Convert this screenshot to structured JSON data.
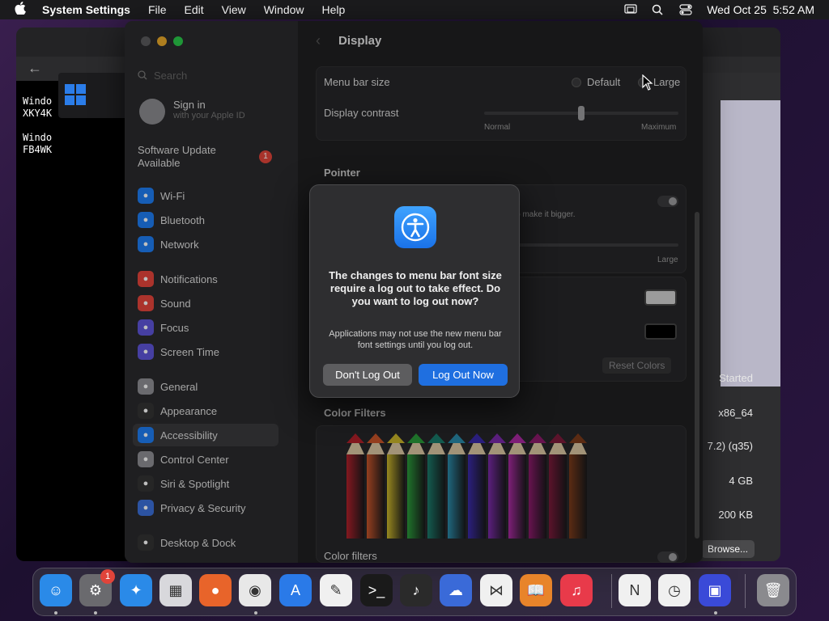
{
  "menubar": {
    "app_name": "System Settings",
    "items": [
      "File",
      "Edit",
      "View",
      "Window",
      "Help"
    ],
    "datetime": "Wed Oct 25  5:52 AM"
  },
  "background_window": {
    "left_text": "Windo\nXKY4K\n\nWindo\nFB4WK",
    "values": [
      "Started",
      "x86_64",
      "7.2) (q35)",
      "4 GB",
      "200 KB"
    ],
    "browse_label": "Browse..."
  },
  "sidebar": {
    "search_placeholder": "Search",
    "signin_title": "Sign in",
    "signin_subtitle": "with your Apple ID",
    "software_update": "Software Update Available",
    "software_update_badge": "1",
    "items": [
      {
        "label": "Wi-Fi",
        "icon": "wifi-icon",
        "color": "#1e7cf2"
      },
      {
        "label": "Bluetooth",
        "icon": "bluetooth-icon",
        "color": "#1e7cf2"
      },
      {
        "label": "Network",
        "icon": "network-icon",
        "color": "#1e7cf2"
      },
      {
        "label": "Notifications",
        "icon": "bell-icon",
        "color": "#e5453b"
      },
      {
        "label": "Sound",
        "icon": "speaker-icon",
        "color": "#e5453b"
      },
      {
        "label": "Focus",
        "icon": "moon-icon",
        "color": "#5e55d8"
      },
      {
        "label": "Screen Time",
        "icon": "hourglass-icon",
        "color": "#5e55d8"
      },
      {
        "label": "General",
        "icon": "gear-icon",
        "color": "#8e8e93"
      },
      {
        "label": "Appearance",
        "icon": "appearance-icon",
        "color": "#333"
      },
      {
        "label": "Accessibility",
        "icon": "accessibility-icon",
        "color": "#1e7cf2"
      },
      {
        "label": "Control Center",
        "icon": "control-center-icon",
        "color": "#8e8e93"
      },
      {
        "label": "Siri & Spotlight",
        "icon": "siri-icon",
        "color": "#333"
      },
      {
        "label": "Privacy & Security",
        "icon": "hand-icon",
        "color": "#3b6fd8"
      },
      {
        "label": "Desktop & Dock",
        "icon": "dock-icon",
        "color": "#333"
      }
    ]
  },
  "content": {
    "title": "Display",
    "menu_bar_size_label": "Menu bar size",
    "menu_bar_size_options": [
      "Default",
      "Large"
    ],
    "display_contrast_label": "Display contrast",
    "contrast_min": "Normal",
    "contrast_max": "Maximum",
    "contrast_level": 0.5,
    "pointer_title": "Pointer",
    "pointer_hint": "n to make it bigger.",
    "pointer_size_max": "Large",
    "reset_colors": "Reset Colors",
    "color_filters_title": "Color Filters",
    "color_filters_label": "Color filters",
    "pencil_colors": [
      "#b0202a",
      "#c8542a",
      "#c9b52a",
      "#2a9a3a",
      "#1a7a6a",
      "#2a8aa8",
      "#3a2aa8",
      "#7a2aa8",
      "#a82aa0",
      "#8a1a6a",
      "#7a1a3a",
      "#7a3a1a"
    ]
  },
  "dialog": {
    "title": "The changes to menu bar font size require a log out to take effect. Do you want to log out now?",
    "body": "Applications may not use the new menu bar font settings until you log out.",
    "secondary_button": "Don't Log Out",
    "primary_button": "Log Out Now"
  },
  "dock": {
    "settings_badge": "1",
    "apps": [
      {
        "name": "finder-icon",
        "color": "#2a8ae8",
        "glyph": "☺"
      },
      {
        "name": "system-settings-icon",
        "color": "#6a6a6e",
        "glyph": "⚙"
      },
      {
        "name": "safari-icon",
        "color": "#2a8ae8",
        "glyph": "✦"
      },
      {
        "name": "launchpad-icon",
        "color": "#d8d8dc",
        "glyph": "▦"
      },
      {
        "name": "firefox-icon",
        "color": "#e8642a",
        "glyph": "●"
      },
      {
        "name": "chrome-icon",
        "color": "#e8e8e8",
        "glyph": "◉"
      },
      {
        "name": "app-store-icon",
        "color": "#2a7ae8",
        "glyph": "A"
      },
      {
        "name": "textedit-icon",
        "color": "#f0f0f0",
        "glyph": "✎"
      },
      {
        "name": "terminal-icon",
        "color": "#1a1a1a",
        "glyph": ">_"
      },
      {
        "name": "garageband-icon",
        "color": "#2a2a2a",
        "glyph": "♪"
      },
      {
        "name": "weather-icon",
        "color": "#3a6ad8",
        "glyph": "☁"
      },
      {
        "name": "vscode-icon",
        "color": "#f0f0f0",
        "glyph": "⋈"
      },
      {
        "name": "books-icon",
        "color": "#e8842a",
        "glyph": "📖"
      },
      {
        "name": "music-icon",
        "color": "#e83a4a",
        "glyph": "♫"
      },
      {
        "name": "news-icon",
        "color": "#f0f0f0",
        "glyph": "N"
      },
      {
        "name": "clock-icon",
        "color": "#f0f0f0",
        "glyph": "◷"
      },
      {
        "name": "screen-sharing-icon",
        "color": "#3a4ad8",
        "glyph": "▣"
      },
      {
        "name": "trash-icon",
        "color": "#8a8a8e",
        "glyph": "🗑"
      }
    ]
  }
}
